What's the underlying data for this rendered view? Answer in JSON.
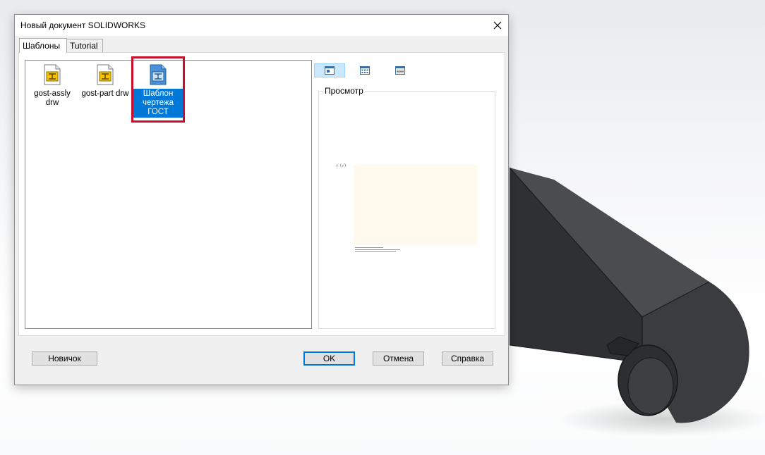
{
  "dialog": {
    "title": "Новый документ SOLIDWORKS",
    "tabs": [
      {
        "label": "Шаблоны",
        "active": true
      },
      {
        "label": "Tutorial",
        "active": false
      }
    ],
    "templates": [
      {
        "label": "gost-assly drw",
        "icon": "assembly-drawing-template-icon",
        "selected": false
      },
      {
        "label": "gost-part drw",
        "icon": "part-drawing-template-icon",
        "selected": false
      },
      {
        "label": "Шаблон чертежа ГОСТ",
        "icon": "drawing-template-icon",
        "selected": true
      }
    ],
    "view_modes": [
      {
        "icon": "large-icons-view-icon",
        "active": true
      },
      {
        "icon": "list-view-icon",
        "active": false
      },
      {
        "icon": "details-view-icon",
        "active": false
      }
    ],
    "preview": {
      "label": "Просмотр"
    },
    "buttons": {
      "novice": "Новичок",
      "ok": "OK",
      "cancel": "Отмена",
      "help": "Справка"
    }
  },
  "colors": {
    "accent": "#0078d7",
    "highlight": "#c8102e",
    "part_body": "#3c3e42"
  }
}
